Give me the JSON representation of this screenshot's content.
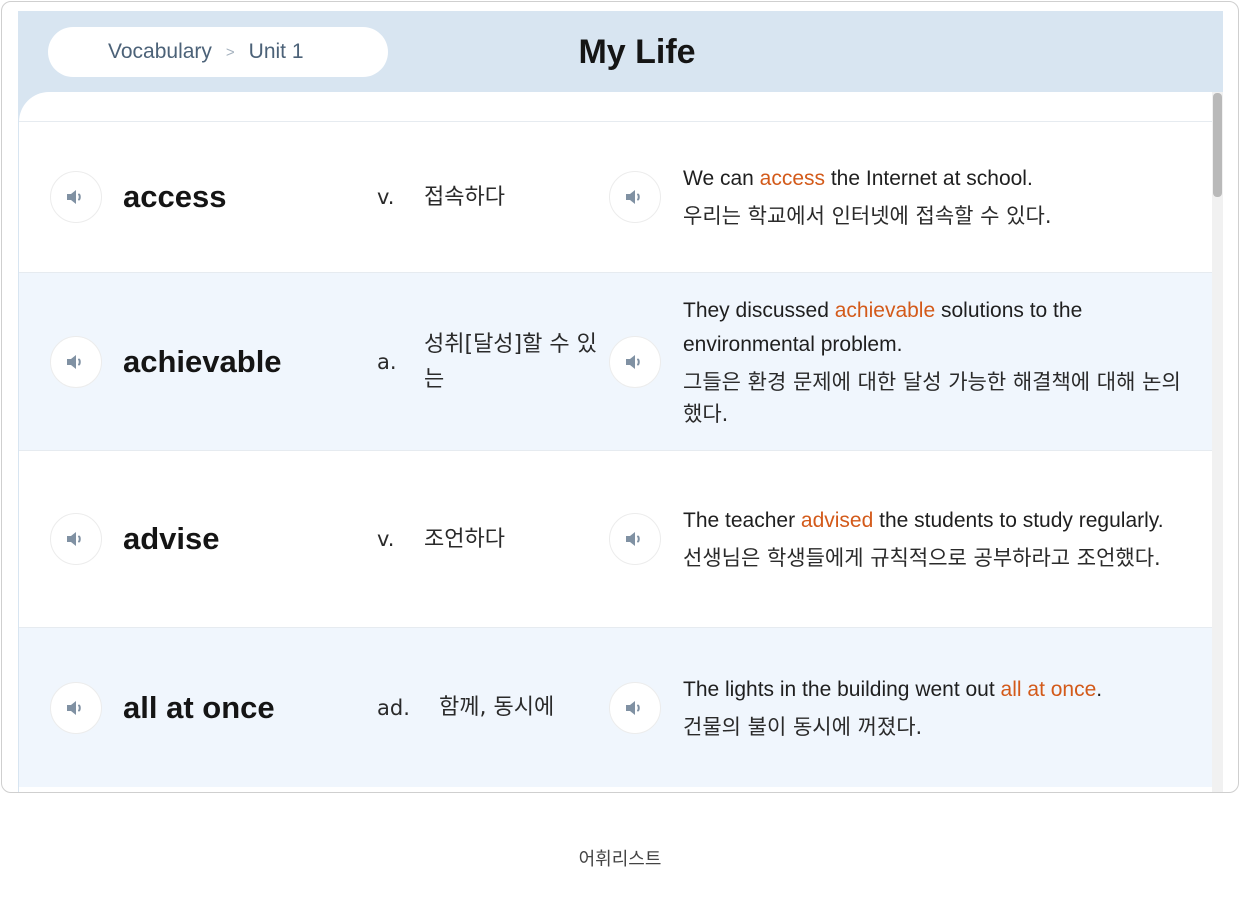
{
  "breadcrumb": {
    "section": "Vocabulary",
    "separator": ">",
    "unit": "Unit 1"
  },
  "page_title": "My Life",
  "rows": [
    {
      "word": "access",
      "pos": "v.",
      "meaning": "접속하다",
      "example_en_before": "We can ",
      "example_en_highlight": "access",
      "example_en_after": " the Internet at school.",
      "example_ko": "우리는 학교에서 인터넷에 접속할 수 있다."
    },
    {
      "word": "achievable",
      "pos": "a.",
      "meaning": "성취[달성]할 수 있는",
      "example_en_before": "They discussed ",
      "example_en_highlight": "achievable",
      "example_en_after": " solutions to the environmental problem.",
      "example_ko": "그들은 환경 문제에 대한 달성 가능한 해결책에 대해 논의했다."
    },
    {
      "word": "advise",
      "pos": "v.",
      "meaning": "조언하다",
      "example_en_before": "The teacher ",
      "example_en_highlight": "advised",
      "example_en_after": " the students to study regularly.",
      "example_ko": "선생님은 학생들에게 규칙적으로 공부하라고 조언했다."
    },
    {
      "word": "all at once",
      "pos": "ad.",
      "meaning": "함께, 동시에",
      "example_en_before": "The lights in the building went out ",
      "example_en_highlight": "all at once",
      "example_en_after": ".",
      "example_ko": "건물의 불이 동시에 꺼졌다."
    }
  ],
  "caption": "어휘리스트",
  "icons": {
    "audio": "speaker-icon",
    "separator": "chevron-right-icon"
  },
  "colors": {
    "header_bg": "#d8e5f1",
    "alt_row_bg": "#f0f6fd",
    "highlight": "#d35a1a",
    "breadcrumb_text": "#4c6278"
  }
}
